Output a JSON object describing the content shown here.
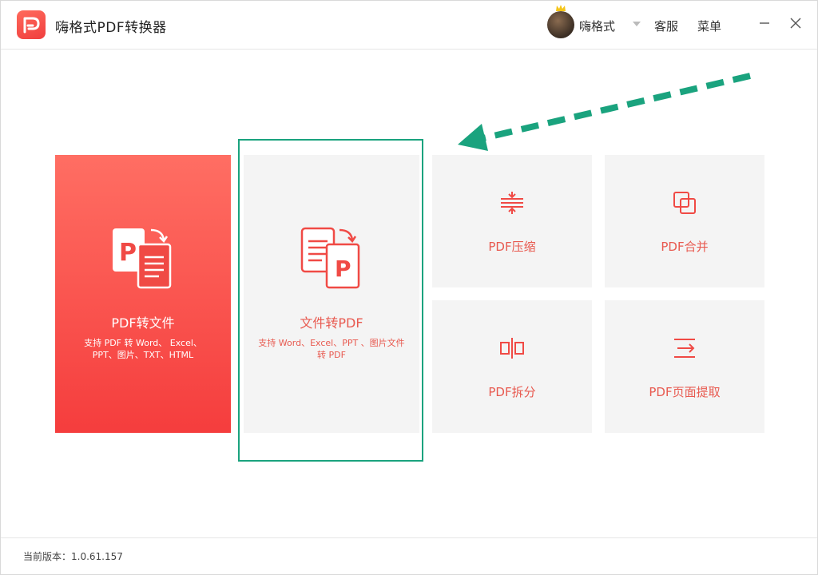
{
  "app": {
    "title": "嗨格式PDF转换器"
  },
  "user": {
    "name": "嗨格式"
  },
  "titlebar": {
    "service_label": "客服",
    "menu_label": "菜单"
  },
  "cards": {
    "pdf_to_file": {
      "title": "PDF转文件",
      "desc": "支持 PDF 转 Word、 Excel、 PPT、图片、TXT、HTML"
    },
    "file_to_pdf": {
      "title": "文件转PDF",
      "desc": "支持 Word、Excel、PPT 、图片文件转 PDF"
    },
    "compress": {
      "title": "PDF压缩"
    },
    "merge": {
      "title": "PDF合并"
    },
    "split": {
      "title": "PDF拆分"
    },
    "extract": {
      "title": "PDF页面提取"
    }
  },
  "footer": {
    "version_label": "当前版本：1.0.61.157"
  },
  "colors": {
    "accent": "#f04a45",
    "highlight": "#1aa37e",
    "card_bg": "#f4f4f4"
  },
  "icons": [
    "app-logo-icon",
    "crown-icon",
    "caret-down-icon",
    "minimize-icon",
    "close-icon",
    "pdf-to-file-icon",
    "file-to-pdf-icon",
    "compress-icon",
    "merge-icon",
    "split-icon",
    "extract-icon"
  ]
}
